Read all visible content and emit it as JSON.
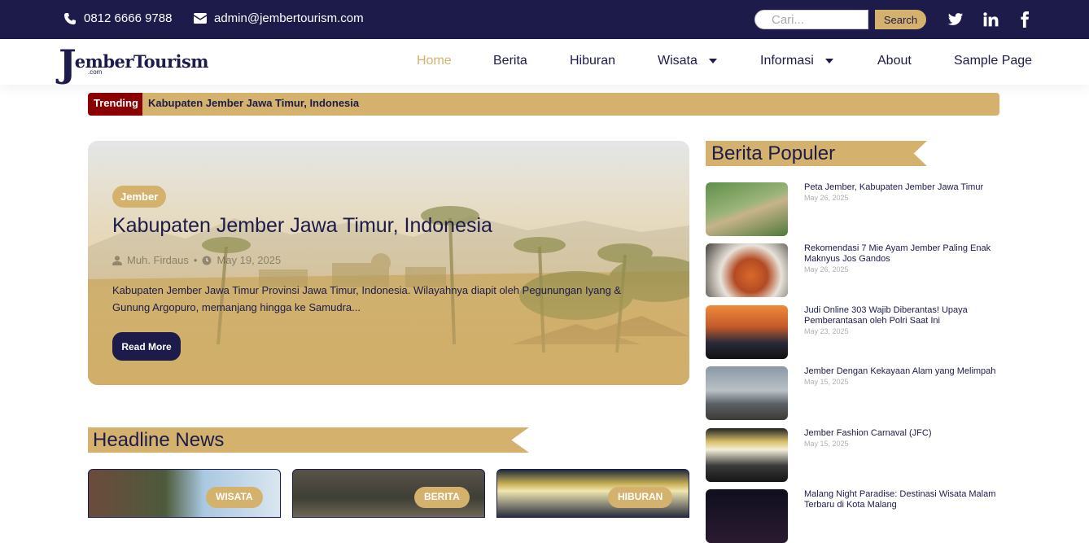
{
  "topbar": {
    "phone": "0812 6666 9788",
    "email": "admin@jembertourism.com",
    "search_placeholder": "Cari...",
    "search_button": "Search",
    "social": [
      "twitter-icon",
      "linkedin-icon",
      "facebook-icon"
    ]
  },
  "brand": {
    "logo_letter": "J",
    "logo_text": "emberTourism",
    "logo_suffix": ".com"
  },
  "nav": {
    "items": [
      {
        "label": "Home",
        "active": true
      },
      {
        "label": "Berita"
      },
      {
        "label": "Hiburan"
      },
      {
        "label": "Wisata",
        "dropdown": true
      },
      {
        "label": "Informasi",
        "dropdown": true
      },
      {
        "label": "About"
      },
      {
        "label": "Sample Page"
      }
    ]
  },
  "trending": {
    "label": "Trending",
    "text": "Kabupaten Jember Jawa Timur, Indonesia"
  },
  "hero": {
    "category": "Jember",
    "title": "Kabupaten Jember Jawa Timur, Indonesia",
    "author": "Muh. Firdaus",
    "date": "May 19, 2025",
    "excerpt": "Kabupaten Jember Jawa Timur Provinsi Jawa Timur, Indonesia. Wilayahnya diapit oleh Pegunungan Iyang & Gunung Argopuro, memanjang hingga ke Samudra...",
    "button": "Read More"
  },
  "headline": {
    "heading": "Headline News",
    "cards": [
      {
        "badge": "WISATA"
      },
      {
        "badge": "BERITA"
      },
      {
        "badge": "HIBURAN"
      }
    ]
  },
  "popular": {
    "heading": "Berita Populer",
    "items": [
      {
        "title": "Peta Jember, Kabupaten Jember Jawa Timur",
        "date": "May 26, 2025"
      },
      {
        "title": "Rekomendasi 7 Mie Ayam Jember Paling Enak Maknyus Jos Gandos",
        "date": "May 26, 2025"
      },
      {
        "title": "Judi Online 303 Wajib Diberantas! Upaya Pemberantasan oleh Polri Saat Ini",
        "date": "May 23, 2025"
      },
      {
        "title": "Jember Dengan Kekayaan Alam yang Melimpah",
        "date": "May 15, 2025"
      },
      {
        "title": "Jember Fashion Carnaval (JFC)",
        "date": "May 15, 2025"
      },
      {
        "title": "Malang Night Paradise: Destinasi Wisata Malam Terbaru di Kota Malang",
        "date": ""
      }
    ]
  },
  "colors": {
    "navy": "#1c1b4a",
    "gold": "#d4b26e",
    "trending_red": "#8b0000"
  }
}
